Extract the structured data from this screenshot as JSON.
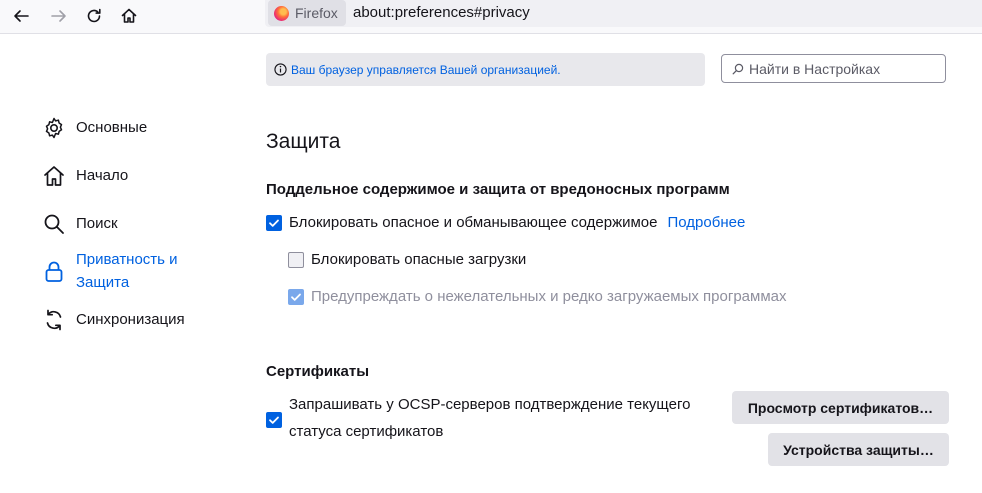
{
  "toolbar": {
    "identity_label": "Firefox",
    "url": "about:preferences#privacy"
  },
  "sidebar": {
    "items": [
      {
        "label": "Основные",
        "icon": "gear-icon"
      },
      {
        "label": "Начало",
        "icon": "home-icon"
      },
      {
        "label": "Поиск",
        "icon": "search-icon"
      },
      {
        "label": "Приватность и Защита",
        "icon": "lock-icon",
        "selected": true
      },
      {
        "label": "Синхронизация",
        "icon": "sync-icon"
      }
    ]
  },
  "policy_banner": "Ваш браузер управляется Вашей организацией.",
  "search": {
    "placeholder": "Найти в Настройках"
  },
  "main": {
    "title": "Защита",
    "deceptive": {
      "heading": "Поддельное содержимое и защита от вредоносных программ",
      "block_dangerous": "Блокировать опасное и обманывающее содержимое",
      "learn_more": "Подробнее",
      "block_downloads": "Блокировать опасные загрузки",
      "warn_unwanted": "Предупреждать о нежелательных и редко загружаемых программах"
    },
    "certificates": {
      "heading": "Сертификаты",
      "ocsp": "Запрашивать у OCSP-серверов подтверждение текущего статуса сертификатов",
      "view_button": "Просмотр сертификатов…",
      "devices_button": "Устройства защиты…"
    }
  },
  "colors": {
    "accent": "#0061e0",
    "toolbar_bg": "#f9f9fb",
    "button_bg": "#e2e2e7"
  }
}
